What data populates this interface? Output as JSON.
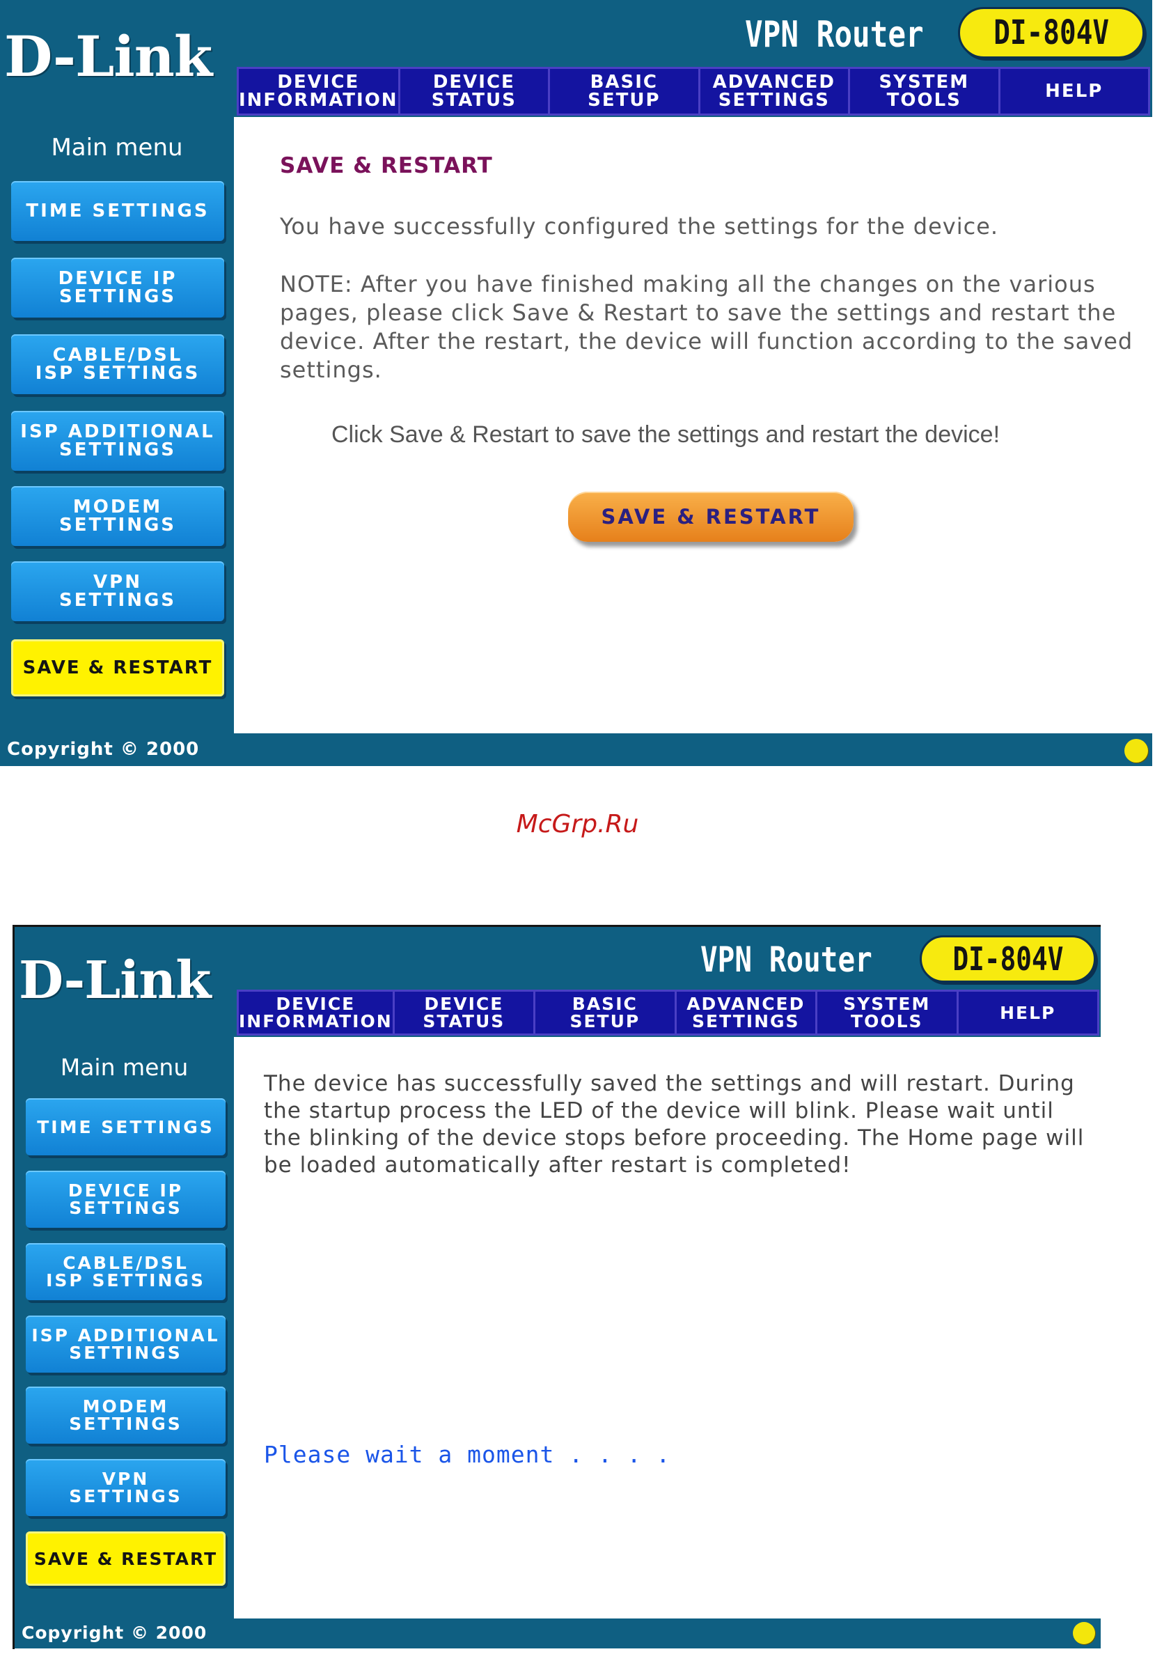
{
  "watermark": "McGrp.Ru",
  "header": {
    "logo": "D-Link",
    "product": "VPN Router",
    "model": "DI-804V"
  },
  "nav": [
    {
      "label": "DEVICE\nINFORMATION"
    },
    {
      "label": "DEVICE\nSTATUS"
    },
    {
      "label": "BASIC\nSETUP"
    },
    {
      "label": "ADVANCED\nSETTINGS"
    },
    {
      "label": "SYSTEM\nTOOLS"
    },
    {
      "label": "HELP"
    }
  ],
  "sidebar": {
    "title": "Main menu",
    "items": [
      {
        "label": "TIME SETTINGS"
      },
      {
        "label": "DEVICE IP\nSETTINGS"
      },
      {
        "label": "CABLE/DSL\nISP SETTINGS"
      },
      {
        "label": "ISP ADDITIONAL\nSETTINGS"
      },
      {
        "label": "MODEM\nSETTINGS"
      },
      {
        "label": "VPN\nSETTINGS"
      },
      {
        "label": "SAVE & RESTART"
      }
    ]
  },
  "footer": {
    "copyright": "Copyright © 2000"
  },
  "screen1": {
    "heading": "SAVE & RESTART",
    "success": "You have successfully configured the settings for the device.",
    "note": "NOTE: After you have finished making all the changes on the various pages, please click Save & Restart to save the settings and restart the device. After the restart, the device will function according to the saved settings.",
    "instruction": "Click Save & Restart to save the settings and restart the device!",
    "button": "SAVE & RESTART"
  },
  "screen2": {
    "message": "The device has successfully saved the settings and will restart. During the startup process the LED of the device will blink. Please wait until the blinking of the device stops before proceeding. The Home page will be loaded automatically after restart is completed!",
    "wait": "Please wait a moment . . . ."
  },
  "colors": {
    "frame_teal": "#0f5f82",
    "nav_blue": "#1414a0",
    "menu_button": "#1a94e2",
    "active_yellow": "#fff200",
    "heading_purple": "#7a125a",
    "cta_orange": "#f29a30",
    "wait_blue": "#1a55e8"
  }
}
